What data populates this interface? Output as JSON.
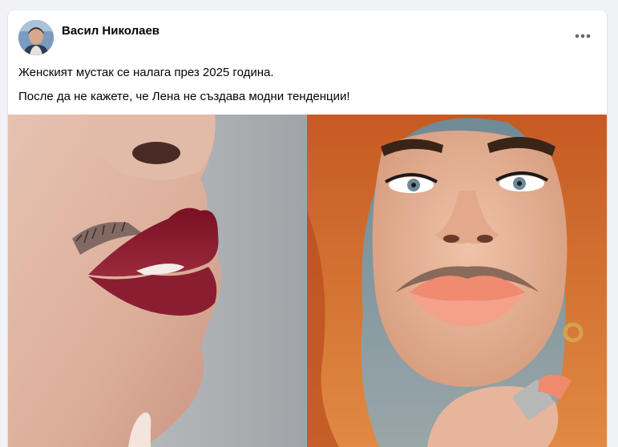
{
  "post": {
    "author": {
      "name": "Васил Николаев",
      "avatar_icon": "profile-photo"
    },
    "menu_icon": "more-horizontal-icon",
    "text_lines": [
      "Женският мустак се налага през 2025 година.",
      "После да не кажете, че Лена не създава модни тенденции!"
    ],
    "media": {
      "images": [
        {
          "subject": "close-up of red lips with moustache hair"
        },
        {
          "subject": "woman with red hair, peach lips and moustache holding lipstick"
        }
      ]
    }
  },
  "colors": {
    "page_background": "#f0f2f5",
    "card_background": "#ffffff",
    "text_primary": "#050505",
    "icon_secondary": "#65676b"
  }
}
